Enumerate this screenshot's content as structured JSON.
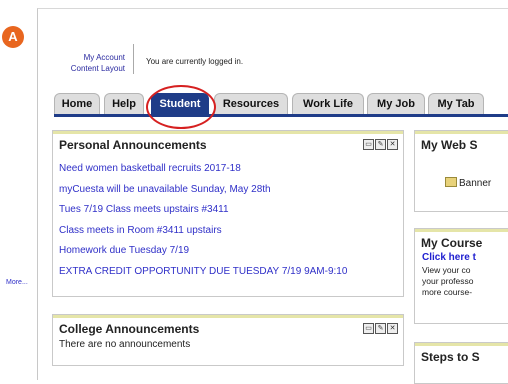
{
  "step_badge": "A",
  "account": {
    "my_account": "My Account",
    "content_layout": "Content Layout",
    "status": "You are currently logged in."
  },
  "tabs": [
    {
      "label": "Home"
    },
    {
      "label": "Help"
    },
    {
      "label": "Student",
      "active": true
    },
    {
      "label": "Resources"
    },
    {
      "label": "Work Life"
    },
    {
      "label": "My Job"
    },
    {
      "label": "My Tab"
    }
  ],
  "personal": {
    "title": "Personal Announcements",
    "items": [
      "Need women basketball recruits 2017-18",
      "myCuesta will be unavailable Sunday, May 28th",
      "Tues 7/19 Class meets upstairs #3411",
      "Class meets in Room #3411 upstairs",
      "Homework due Tuesday 7/19",
      "EXTRA CREDIT OPPORTUNITY DUE TUESDAY 7/19 9AM-9:10"
    ],
    "more": "More..."
  },
  "college": {
    "title": "College Announcements",
    "empty": "There are no announcements"
  },
  "websites": {
    "title": "My Web S",
    "folder": "Banner"
  },
  "courses": {
    "title": "My Course",
    "link": "Click here t",
    "lines": [
      "View your co",
      "your professo",
      "more course-"
    ]
  },
  "steps": {
    "title": "Steps to S"
  },
  "colors": {
    "tab_active": "#1f3c88",
    "link": "#3030c8",
    "badge": "#e8661f",
    "highlight": "#d62020"
  }
}
